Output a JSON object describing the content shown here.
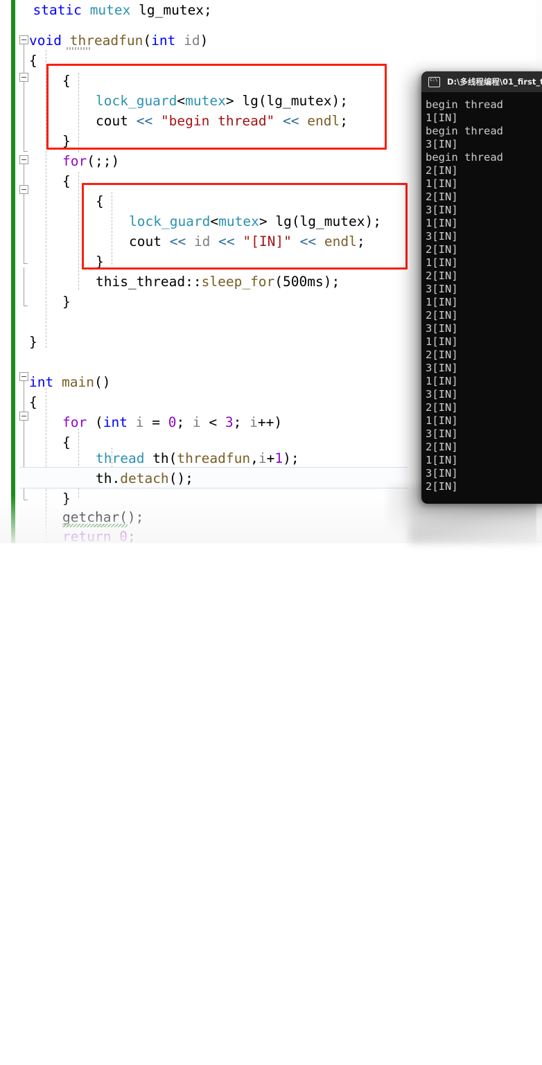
{
  "app": {
    "kind": "visual-studio-code-editor-with-console",
    "accent_annotation_color": "#fb1f10",
    "change_bar_color": "#198c19"
  },
  "editor": {
    "name": "code-editor",
    "language": "C++",
    "current_line_text": "th.detach();",
    "lines": [
      "    static mutex lg_mutex;",
      "void threadfun(int id)",
      "{",
      "    {",
      "        lock_guard<mutex> lg(lg_mutex);",
      "        cout << \"begin thread\" << endl;",
      "    }",
      "    for(;;)",
      "    {",
      "        {",
      "            lock_guard<mutex> lg(lg_mutex);",
      "            cout << id << \"[IN]\" << endl;",
      "        }",
      "        this_thread::sleep_for(500ms);",
      "    }",
      "",
      "}",
      "",
      "int main()",
      "{",
      "    for (int i = 0; i < 3; i++)",
      "    {",
      "        thread th(threadfun,i+1);",
      "        th.detach();",
      "    }",
      "    getchar();",
      "    return 0;"
    ],
    "tokens": {
      "static": "static",
      "mutex": "mutex",
      "lg_mutex": "lg_mutex",
      "semicolon": ";",
      "void": "void",
      "threadfun": "threadfun",
      "int": "int",
      "id": "id",
      "brace_open": "{",
      "brace_close": "}",
      "lock_guard": "lock_guard",
      "lt": "<",
      "gt": ">",
      "lg": "lg",
      "cout": "cout",
      "shift": "<<",
      "str_begin_thread": "\"begin thread\"",
      "endl": "endl",
      "for": "for",
      "for_infinite": "(;;)",
      "str_in": "\"[IN]\"",
      "this_thread": "this_thread",
      "scope": "::",
      "sleep_for": "sleep_for",
      "ms500": "500ms",
      "main": "main",
      "i": "i",
      "zero": "0",
      "three": "3",
      "i_plus_plus": "i++",
      "thread": "thread",
      "th": "th",
      "threadfun_arg": "threadfun,i+1",
      "detach": "detach",
      "getchar": "getchar",
      "return": "return",
      "return_value": "0"
    },
    "annotations": [
      {
        "name": "red-box-begin-thread-block",
        "label": "highlight rectangle around first lock_guard scope"
      },
      {
        "name": "red-box-loop-print-block",
        "label": "highlight rectangle around loop lock_guard scope"
      }
    ]
  },
  "console": {
    "name": "output-console-window",
    "title": "D:\\多线程编程\\01_first_t",
    "icon": "console-icon",
    "background": "#0c0c0c",
    "text_color": "#cccccc",
    "lines": [
      "begin thread",
      "1[IN]",
      "begin thread",
      "3[IN]",
      "begin thread",
      "2[IN]",
      "1[IN]",
      "2[IN]",
      "3[IN]",
      "1[IN]",
      "3[IN]",
      "2[IN]",
      "1[IN]",
      "2[IN]",
      "3[IN]",
      "1[IN]",
      "2[IN]",
      "3[IN]",
      "1[IN]",
      "2[IN]",
      "3[IN]",
      "1[IN]",
      "3[IN]",
      "2[IN]",
      "1[IN]",
      "3[IN]",
      "2[IN]",
      "1[IN]",
      "3[IN]",
      "2[IN]"
    ]
  }
}
